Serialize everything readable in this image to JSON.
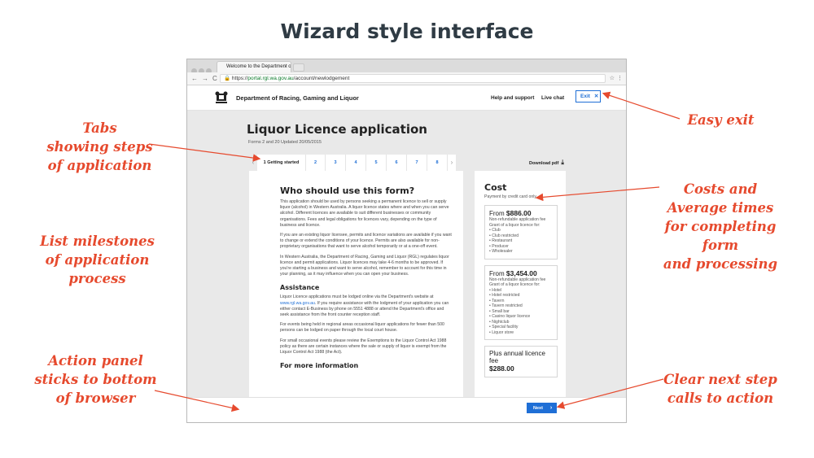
{
  "slide": {
    "title": "Wizard style interface"
  },
  "annotations": {
    "tabs": [
      "Tabs",
      "showing steps",
      "of application"
    ],
    "milestones": [
      "List milestones",
      "of application process"
    ],
    "action_panel": [
      "Action panel",
      "sticks to bottom",
      "of browser"
    ],
    "easy_exit": [
      "Easy exit"
    ],
    "costs": [
      "Costs and",
      "Average times",
      "for completing form",
      "and processing"
    ],
    "next_step": [
      "Clear next step",
      "calls to action"
    ]
  },
  "browser": {
    "tab_title": "Welcome to the Department o",
    "url_prefix": "https://",
    "url_host": "portal.rgl.wa.gov.au",
    "url_path": "/account/newlodgement"
  },
  "header": {
    "department": "Department of Racing, Gaming and Liquor",
    "help": "Help and support",
    "live_chat": "Live chat",
    "exit": "Exit"
  },
  "page": {
    "title": "Liquor Licence application",
    "meta": "Forms 2 and 20  Updated 20/05/2015",
    "download": "Download pdf"
  },
  "steps": [
    "1  Getting started",
    "2",
    "3",
    "4",
    "5",
    "6",
    "7",
    "8"
  ],
  "content": {
    "heading": "Who should use this form?",
    "p1": "This application should be used by persons seeking a permanent licence to sell or supply liquor (alcohol) in Western Australia. A liquor licence states where and when you can serve alcohol. Different licences are available to suit different businesses or community organisations. Fees and legal obligations for licences vary, depending on the type of business and licence.",
    "p2": "If you are an existing liquor licensee, permits and licence variations are available if you want to change or extend the conditions of your licence. Permits are also available for non-proprietary organisations that want to serve alcohol temporarily or at a one-off event.",
    "p3": "In Western Australia, the Department of Racing, Gaming and Liquor (RGL) regulates liquor licence and permit applications. Liquor licences may take 4-6 months to be approved. If you're starting a business and want to serve alcohol, remember to account for this time in your planning, as it may influence when you can open your business.",
    "assist_heading": "Assistance",
    "a1_pre": "Liquor Licence applications must be lodged online via the Department's website at ",
    "a1_link": "www.rgl.wa.gov.au",
    "a1_post": ". If you require assistance with the lodgment of your application you can either contact E-Business by phone on 5551 4888 or attend the Department's office and seek assistance from the front counter reception staff.",
    "a2": "For events being held in regional areas occasional liquor applications for fewer than 500 persons can be lodged on paper through the local court house.",
    "a3": "For small occasional events please review the Exemptions to the Liquor Control Act 1988 policy as there are certain instances where the sale or supply of liquor is exempt from the Liquor Control Act 1988 (the Act).",
    "more_heading": "For more information"
  },
  "cost": {
    "heading": "Cost",
    "payment": "Payment by credit card only.",
    "boxes": [
      {
        "from": "From",
        "amount": "$886.00",
        "note1": "Non-refundable application fee",
        "note2": "Grant of a liquor licence for:",
        "items": [
          "Club",
          "Club restricted",
          "Restaurant",
          "Producer",
          "Wholesaler"
        ]
      },
      {
        "from": "From",
        "amount": "$3,454.00",
        "note1": "Non-refundable application fee",
        "note2": "Grant of a liquor licence for:",
        "items": [
          "Hotel",
          "Hotel restricted",
          "Tavern",
          "Tavern restricted",
          "Small bar",
          "Casino liquor licence",
          "Nightclub",
          "Special facility",
          "Liquor store"
        ]
      },
      {
        "label": "Plus annual licence fee",
        "amount": "$288.00"
      }
    ]
  },
  "actions": {
    "next": "Next"
  }
}
